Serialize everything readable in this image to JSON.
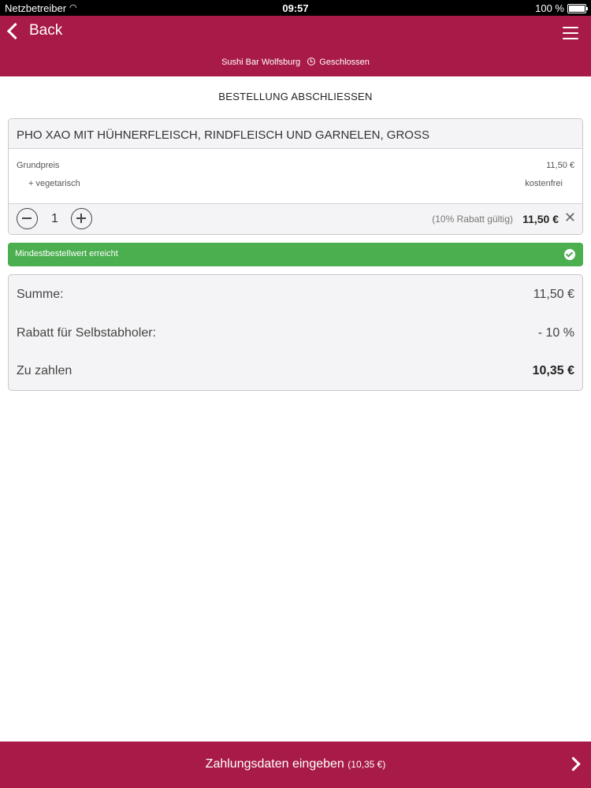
{
  "status_bar": {
    "carrier": "Netzbetreiber",
    "time": "09:57",
    "battery": "100 %"
  },
  "header": {
    "back_label": "Back",
    "restaurant": "Sushi Bar Wolfsburg",
    "status": "Geschlossen"
  },
  "page_title": "BESTELLUNG ABSCHLIESSEN",
  "item": {
    "name": "PHO XAO MIT HÜHNERFLEISCH, RINDFLEISCH UND GARNELEN, GROSS",
    "base_label": "Grundpreis",
    "base_price": "11,50 €",
    "option_label": "+ vegetarisch",
    "option_price": "kostenfrei",
    "quantity": "1",
    "discount_note": "(10% Rabatt gültig)",
    "total": "11,50 €"
  },
  "min_order": {
    "label": "Mindestbestellwert erreicht"
  },
  "summary": {
    "sum_label": "Summe:",
    "sum_value": "11,50 €",
    "discount_label": "Rabatt für Selbstabholer:",
    "discount_value": "- 10 %",
    "pay_label": "Zu zahlen",
    "pay_value": "10,35 €"
  },
  "bottom": {
    "label": "Zahlungsdaten eingeben",
    "amount": "(10,35 €)"
  },
  "colors": {
    "brand": "#a81a48",
    "success": "#4bae4f"
  }
}
